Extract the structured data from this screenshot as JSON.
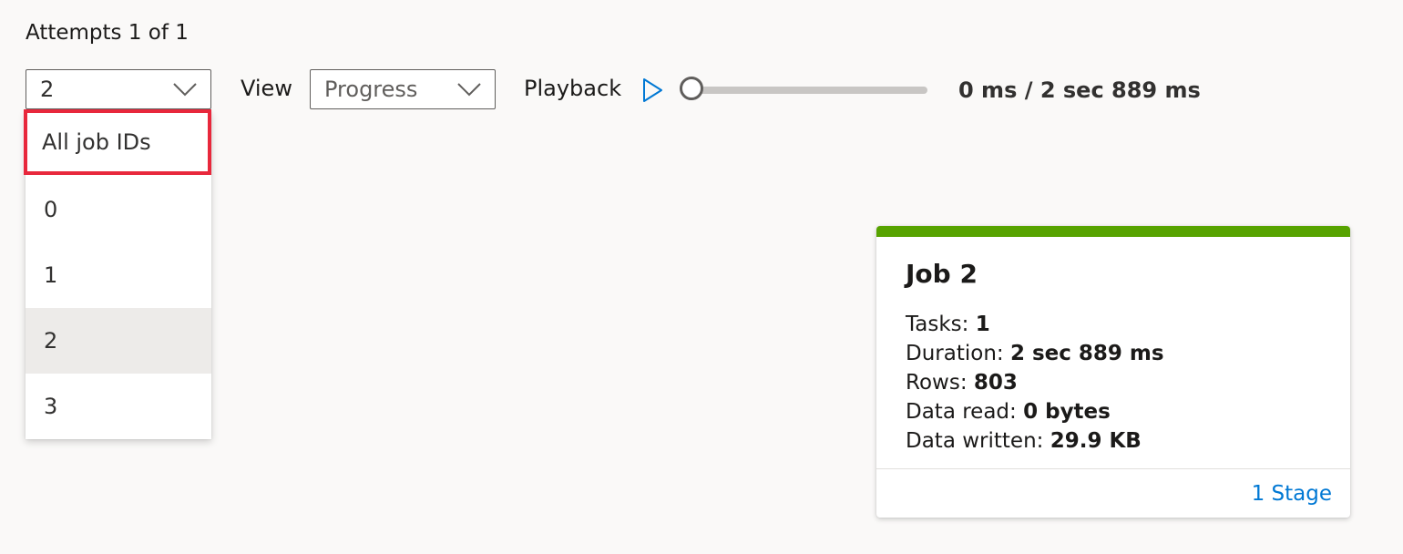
{
  "attempts_label": "Attempts 1 of 1",
  "job_select": {
    "value": "2",
    "options": [
      "All job IDs",
      "0",
      "1",
      "2",
      "3"
    ],
    "selected_index": 3,
    "highlighted_index": 0
  },
  "view": {
    "label": "View",
    "value": "Progress"
  },
  "playback": {
    "label": "Playback",
    "position_fraction": 0,
    "time_readout": "0 ms / 2 sec 889 ms"
  },
  "job_card": {
    "title": "Job 2",
    "stats": [
      {
        "label": "Tasks: ",
        "value": "1"
      },
      {
        "label": "Duration: ",
        "value": "2 sec 889 ms"
      },
      {
        "label": "Rows: ",
        "value": "803"
      },
      {
        "label": "Data read: ",
        "value": "0 bytes"
      },
      {
        "label": "Data written: ",
        "value": "29.9 KB"
      }
    ],
    "stages_link": "1 Stage"
  },
  "colors": {
    "status_bar": "#57a300",
    "link": "#0078d4",
    "highlight_border": "#e8283c"
  }
}
